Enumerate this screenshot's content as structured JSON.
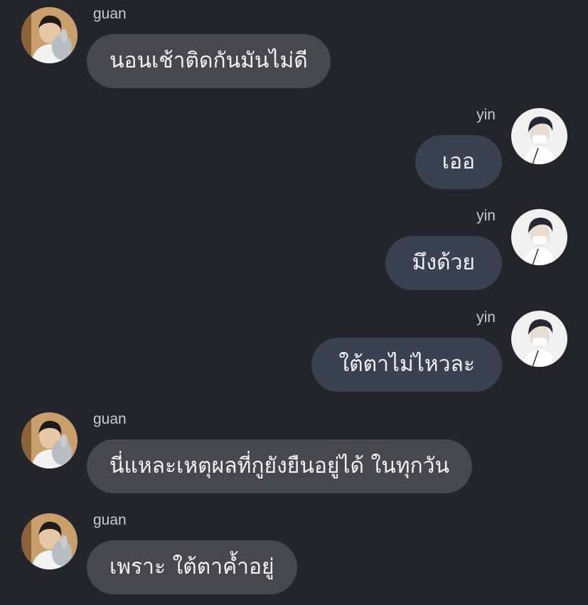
{
  "messages": [
    {
      "sender": "guan",
      "text": "นอนเช้าติดกันมันไม่ดี",
      "direction": "incoming"
    },
    {
      "sender": "yin",
      "text": "เออ",
      "direction": "outgoing"
    },
    {
      "sender": "yin",
      "text": "มึงด้วย",
      "direction": "outgoing"
    },
    {
      "sender": "yin",
      "text": "ใต้ตาไม่ไหวละ",
      "direction": "outgoing"
    },
    {
      "sender": "guan",
      "text": "นี่แหละเหตุผลที่กูยังยืนอยู่ได้ ในทุกวัน",
      "direction": "incoming"
    },
    {
      "sender": "guan",
      "text": "เพราะ ใต้ตาค้ำอยู่",
      "direction": "outgoing_none"
    }
  ],
  "colors": {
    "background": "#23242c",
    "incoming_bubble": "#46474f",
    "outgoing_bubble": "#3a4252",
    "text": "#f3f3f5",
    "sender_name": "#c9cbd2"
  }
}
